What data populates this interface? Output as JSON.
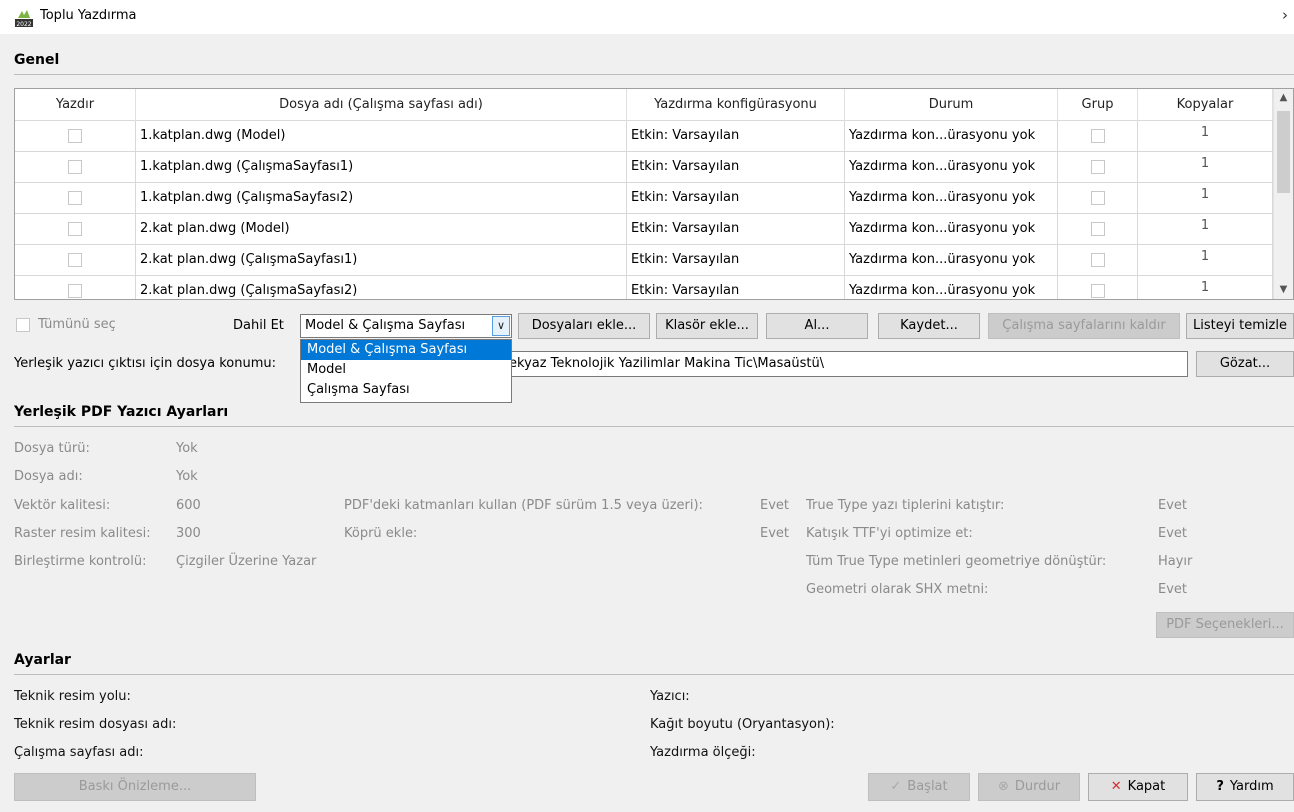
{
  "window": {
    "title": "Toplu Yazdırma",
    "chevron": "›",
    "icon": "autocad-2022-app-icon"
  },
  "general": {
    "section_title": "Genel",
    "columns": [
      "Yazdır",
      "Dosya adı (Çalışma sayfası adı)",
      "Yazdırma konfigürasyonu",
      "Durum",
      "Grup",
      "Kopyalar"
    ],
    "rows": [
      {
        "file": "1.katplan.dwg (Model)",
        "config": "Etkin: Varsayılan",
        "status": "Yazdırma kon...ürasyonu yok",
        "copies": "1"
      },
      {
        "file": "1.katplan.dwg (ÇalışmaSayfası1)",
        "config": "Etkin: Varsayılan",
        "status": "Yazdırma kon...ürasyonu yok",
        "copies": "1"
      },
      {
        "file": "1.katplan.dwg (ÇalışmaSayfası2)",
        "config": "Etkin: Varsayılan",
        "status": "Yazdırma kon...ürasyonu yok",
        "copies": "1"
      },
      {
        "file": "2.kat plan.dwg (Model)",
        "config": "Etkin: Varsayılan",
        "status": "Yazdırma kon...ürasyonu yok",
        "copies": "1"
      },
      {
        "file": "2.kat plan.dwg (ÇalışmaSayfası1)",
        "config": "Etkin: Varsayılan",
        "status": "Yazdırma kon...ürasyonu yok",
        "copies": "1"
      },
      {
        "file": "2.kat plan.dwg (ÇalışmaSayfası2)",
        "config": "Etkin: Varsayılan",
        "status": "Yazdırma kon...ürasyonu yok",
        "copies": "1"
      }
    ],
    "scroll_up": "▲",
    "scroll_down": "▼"
  },
  "controls": {
    "select_all": "Tümünü seç",
    "include_label": "Dahil Et",
    "include_value": "Model & Çalışma Sayfası",
    "include_options": [
      "Model & Çalışma Sayfası",
      "Model",
      "Çalışma Sayfası"
    ],
    "combo_arrow": "∨",
    "buttons": {
      "add_files": "Dosyaları ekle...",
      "add_folder": "Klasör ekle...",
      "load": "Al...",
      "save": "Kaydet...",
      "remove_sheets": "Çalışma sayfalarını kaldır",
      "clear_list": "Listeyi temizle"
    },
    "output_location_label": "Yerleşik yazıcı çıktısı için dosya konumu:",
    "output_location_value": "ekyaz Teknolojik Yazilimlar Makina Tic\\Masaüstü\\",
    "browse": "Gözat..."
  },
  "pdf": {
    "section_title": "Yerleşik PDF Yazıcı Ayarları",
    "file_type_label": "Dosya türü:",
    "file_type_value": "Yok",
    "file_name_label": "Dosya adı:",
    "file_name_value": "Yok",
    "vector_label": "Vektör kalitesi:",
    "vector_value": "600",
    "raster_label": "Raster resim kalitesi:",
    "raster_value": "300",
    "merge_label": "Birleştirme kontrolü:",
    "merge_value": "Çizgiler Üzerine Yazar",
    "layers_label": "PDF'deki katmanları kullan (PDF sürüm 1.5 veya üzeri):",
    "layers_value": "Evet",
    "hyperlink_label": "Köprü ekle:",
    "hyperlink_value": "Evet",
    "embed_tt_label": "True Type yazı tiplerini katıştır:",
    "embed_tt_value": "Evet",
    "optimize_ttf_label": "Katışık TTF'yi optimize et:",
    "optimize_ttf_value": "Evet",
    "tt_geometry_label": "Tüm True Type metinleri geometriye dönüştür:",
    "tt_geometry_value": "Hayır",
    "shx_label": "Geometri olarak SHX metni:",
    "shx_value": "Evet",
    "options_button": "PDF Seçenekleri..."
  },
  "settings": {
    "section_title": "Ayarlar",
    "drawing_path_label": "Teknik resim yolu:",
    "drawing_file_label": "Teknik resim dosyası adı:",
    "sheet_name_label": "Çalışma sayfası adı:",
    "printer_label": "Yazıcı:",
    "paper_label": "Kağıt boyutu (Oryantasyon):",
    "scale_label": "Yazdırma ölçeği:"
  },
  "footer": {
    "preview": "Baskı Önizleme...",
    "start": "Başlat",
    "stop": "Durdur",
    "close": "Kapat",
    "help": "Yardım"
  },
  "colors": {
    "accent": "#0078d7",
    "close_x": "#d32f2f",
    "disabled_text": "#8a8a8a"
  }
}
